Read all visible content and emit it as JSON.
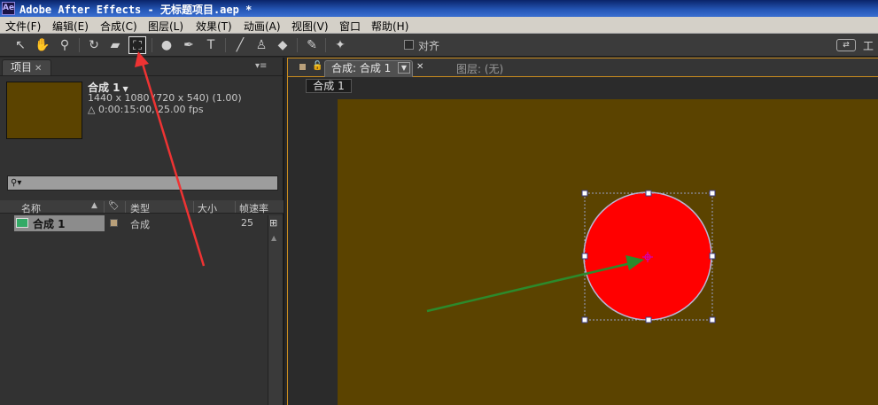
{
  "window": {
    "title": "Adobe After Effects - 无标题项目.aep *",
    "logo": "Ae"
  },
  "menu": [
    "文件(F)",
    "编辑(E)",
    "合成(C)",
    "图层(L)",
    "效果(T)",
    "动画(A)",
    "视图(V)",
    "窗口",
    "帮助(H)"
  ],
  "toolbar": {
    "tools": [
      "selection-tool-icon",
      "hand-tool-icon",
      "zoom-tool-icon",
      "rotation-tool-icon",
      "camera-tool-icon",
      "pan-behind-tool-icon",
      "ellipse-tool-icon",
      "pen-tool-icon",
      "type-tool-icon",
      "brush-tool-icon",
      "clone-stamp-tool-icon",
      "eraser-tool-icon",
      "roto-brush-tool-icon",
      "puppet-pin-tool-icon"
    ],
    "snap_label": "对齐",
    "workspace_label": "工"
  },
  "project": {
    "tab_label": "项目",
    "comp_name": "合成 1",
    "comp_resolution": "1440 x 1080  (720 x 540) (1.00)",
    "comp_duration": "△ 0:00:15:00, 25.00 fps",
    "search_placeholder": "",
    "columns": {
      "name": "名称",
      "type": "类型",
      "size": "大小",
      "fps": "帧速率"
    },
    "items": [
      {
        "name": "合成 1",
        "type": "合成",
        "fps": "25"
      }
    ]
  },
  "composition": {
    "tab_label": "合成: 合成 1",
    "layer_tab_label": "图层: (无)",
    "breadcrumb": "合成 1"
  },
  "colors": {
    "canvas": "#5b4300",
    "circle": "#ff0000",
    "accent": "#c98b1e"
  }
}
